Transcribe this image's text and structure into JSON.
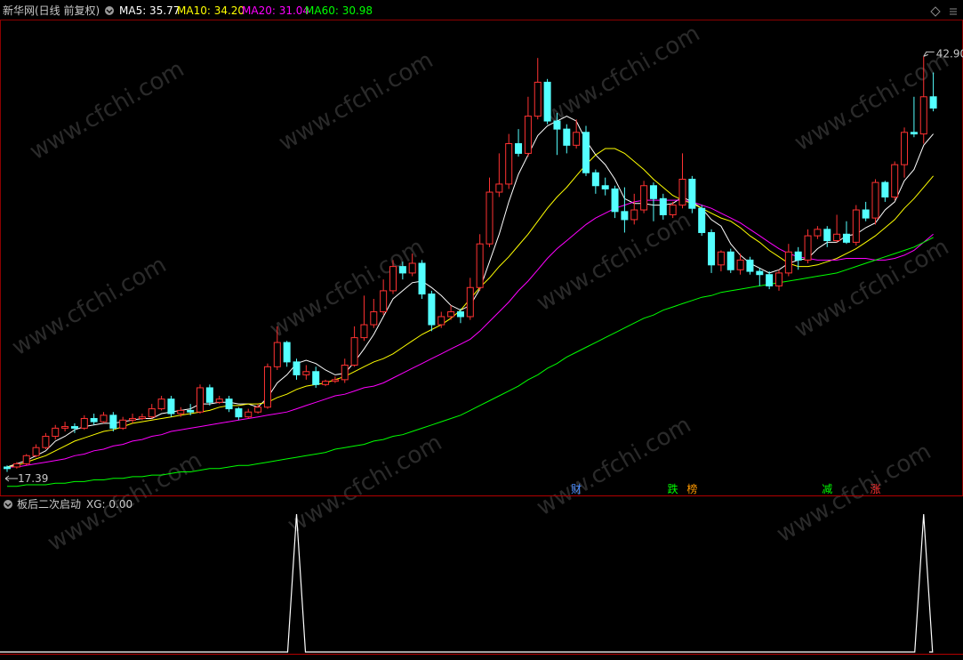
{
  "header": {
    "title": "新华网(日线 前复权)",
    "ma5_label": "MA5: 35.77",
    "ma10_label": "MA10: 34.20",
    "ma20_label": "MA20: 31.04",
    "ma60_label": "MA60: 30.98",
    "colors": {
      "ma5": "#ffffff",
      "ma10": "#ffff00",
      "ma20": "#ff00ff",
      "ma60": "#00ff00"
    }
  },
  "price_annotations": {
    "high": "42.90",
    "low": "17.39"
  },
  "event_tags": [
    {
      "text": "财",
      "color": "#4a8cff",
      "bar": 59
    },
    {
      "text": "跌",
      "color": "#00ff00",
      "bar": 69
    },
    {
      "text": "榜",
      "color": "#ff9900",
      "bar": 71
    },
    {
      "text": "减",
      "color": "#00ff00",
      "bar": 85
    },
    {
      "text": "涨",
      "color": "#ff3333",
      "bar": 90
    }
  ],
  "sub_panel": {
    "title": "板后二次启动",
    "xg_label": "XG: 0.00",
    "signal_bars": [
      30,
      95
    ]
  },
  "bottom_label": "",
  "watermark": "www.cfchi.com",
  "chart_data": {
    "type": "candlestick",
    "title": "新华网(日线 前复权)",
    "price_range": [
      16.5,
      45
    ],
    "candles": [
      [
        17.6,
        17.5,
        17.7,
        17.3
      ],
      [
        17.6,
        17.8,
        17.9,
        17.5
      ],
      [
        17.8,
        18.3,
        18.4,
        17.7
      ],
      [
        18.3,
        18.8,
        19.0,
        18.2
      ],
      [
        18.8,
        19.5,
        19.7,
        18.7
      ],
      [
        19.5,
        20.0,
        20.2,
        19.3
      ],
      [
        20.0,
        20.1,
        20.4,
        19.8
      ],
      [
        20.1,
        20.0,
        20.3,
        19.7
      ],
      [
        20.0,
        20.6,
        20.8,
        19.9
      ],
      [
        20.6,
        20.4,
        20.9,
        20.2
      ],
      [
        20.4,
        20.8,
        21.0,
        20.3
      ],
      [
        20.8,
        20.0,
        21.0,
        19.8
      ],
      [
        20.0,
        20.5,
        20.7,
        19.9
      ],
      [
        20.5,
        20.6,
        20.9,
        20.3
      ],
      [
        20.6,
        20.7,
        20.9,
        20.5
      ],
      [
        20.7,
        21.2,
        21.5,
        20.6
      ],
      [
        21.2,
        21.8,
        22.0,
        21.1
      ],
      [
        21.8,
        20.9,
        22.0,
        20.7
      ],
      [
        20.9,
        21.1,
        21.3,
        20.7
      ],
      [
        21.1,
        21.0,
        21.5,
        20.8
      ],
      [
        21.0,
        22.5,
        22.7,
        20.9
      ],
      [
        22.5,
        21.6,
        22.7,
        21.4
      ],
      [
        21.6,
        21.8,
        22.0,
        21.5
      ],
      [
        21.8,
        21.2,
        22.0,
        21.0
      ],
      [
        21.2,
        20.7,
        21.3,
        20.5
      ],
      [
        20.7,
        21.0,
        21.2,
        20.6
      ],
      [
        21.0,
        21.3,
        21.5,
        20.9
      ],
      [
        21.3,
        23.8,
        24.0,
        21.2
      ],
      [
        23.8,
        25.3,
        26.3,
        23.6
      ],
      [
        25.3,
        24.1,
        25.4,
        23.8
      ],
      [
        24.1,
        23.3,
        24.3,
        23.0
      ],
      [
        23.3,
        23.5,
        23.9,
        23.0
      ],
      [
        23.5,
        22.7,
        23.8,
        22.5
      ],
      [
        22.7,
        22.9,
        23.0,
        22.6
      ],
      [
        22.9,
        23.0,
        23.2,
        22.8
      ],
      [
        23.0,
        23.9,
        24.3,
        22.8
      ],
      [
        23.9,
        25.6,
        26.3,
        23.8
      ],
      [
        25.6,
        26.4,
        28.2,
        25.4
      ],
      [
        26.4,
        27.2,
        28.0,
        26.2
      ],
      [
        27.2,
        28.5,
        29.2,
        27.0
      ],
      [
        28.5,
        30.0,
        30.4,
        28.3
      ],
      [
        30.0,
        29.6,
        30.3,
        29.2
      ],
      [
        29.6,
        30.2,
        30.8,
        29.4
      ],
      [
        30.2,
        28.3,
        30.4,
        28.0
      ],
      [
        28.3,
        26.4,
        28.5,
        26.0
      ],
      [
        26.4,
        26.9,
        27.2,
        26.2
      ],
      [
        26.9,
        27.2,
        27.6,
        26.7
      ],
      [
        27.2,
        26.9,
        27.4,
        26.5
      ],
      [
        26.9,
        28.7,
        29.3,
        26.7
      ],
      [
        28.7,
        31.4,
        32.0,
        28.5
      ],
      [
        31.4,
        34.6,
        35.5,
        31.2
      ],
      [
        34.6,
        35.1,
        37.0,
        34.3
      ],
      [
        35.1,
        37.6,
        38.2,
        34.8
      ],
      [
        37.6,
        37.0,
        38.5,
        36.8
      ],
      [
        37.0,
        39.3,
        40.5,
        36.8
      ],
      [
        39.3,
        41.4,
        42.9,
        39.1
      ],
      [
        41.4,
        39.0,
        41.6,
        38.8
      ],
      [
        39.0,
        38.5,
        39.5,
        36.9
      ],
      [
        38.5,
        37.5,
        38.8,
        37.0
      ],
      [
        37.5,
        38.3,
        39.1,
        37.3
      ],
      [
        38.3,
        35.8,
        38.7,
        35.6
      ],
      [
        35.8,
        35.0,
        36.0,
        34.5
      ],
      [
        35.0,
        34.8,
        35.5,
        34.4
      ],
      [
        34.8,
        33.4,
        35.0,
        33.0
      ],
      [
        33.4,
        32.9,
        34.9,
        32.1
      ],
      [
        32.9,
        33.5,
        34.5,
        32.6
      ],
      [
        33.5,
        35.0,
        35.3,
        33.3
      ],
      [
        35.0,
        34.2,
        35.2,
        32.8
      ],
      [
        34.2,
        33.2,
        34.5,
        32.9
      ],
      [
        33.2,
        33.8,
        34.0,
        33.0
      ],
      [
        33.8,
        35.4,
        37.0,
        33.6
      ],
      [
        35.4,
        33.6,
        35.6,
        33.3
      ],
      [
        33.6,
        32.1,
        33.8,
        31.9
      ],
      [
        32.1,
        30.1,
        32.3,
        29.6
      ],
      [
        30.1,
        30.9,
        31.0,
        29.7
      ],
      [
        30.9,
        29.8,
        31.1,
        29.6
      ],
      [
        29.8,
        30.4,
        30.8,
        29.5
      ],
      [
        30.4,
        29.7,
        30.6,
        29.5
      ],
      [
        29.7,
        29.5,
        29.9,
        28.8
      ],
      [
        29.5,
        28.8,
        29.7,
        28.6
      ],
      [
        28.8,
        29.6,
        29.8,
        28.5
      ],
      [
        29.6,
        30.9,
        31.4,
        29.4
      ],
      [
        30.9,
        30.4,
        31.2,
        29.8
      ],
      [
        30.4,
        31.9,
        32.3,
        30.2
      ],
      [
        31.9,
        32.3,
        32.5,
        31.7
      ],
      [
        32.3,
        31.6,
        32.5,
        31.2
      ],
      [
        31.6,
        32.0,
        33.2,
        31.5
      ],
      [
        32.0,
        31.5,
        32.8,
        31.4
      ],
      [
        31.5,
        33.5,
        33.8,
        31.3
      ],
      [
        33.5,
        33.0,
        34.0,
        32.8
      ],
      [
        33.0,
        35.2,
        35.4,
        32.6
      ],
      [
        35.2,
        34.3,
        35.3,
        34.0
      ],
      [
        34.3,
        36.3,
        36.5,
        34.1
      ],
      [
        36.3,
        38.3,
        38.6,
        35.5
      ],
      [
        38.3,
        38.2,
        40.5,
        38.0
      ],
      [
        38.2,
        40.5,
        43.0,
        37.6
      ],
      [
        40.5,
        39.8,
        42.0,
        39.6
      ]
    ],
    "series": [
      {
        "name": "MA5",
        "color": "#ffffff",
        "values": [
          17.6,
          17.8,
          18.0,
          18.3,
          18.6,
          19.2,
          19.5,
          19.9,
          20.1,
          20.2,
          20.3,
          20.3,
          20.4,
          20.5,
          20.6,
          20.6,
          20.9,
          21.0,
          21.1,
          21.2,
          21.5,
          21.5,
          21.6,
          21.6,
          21.5,
          21.5,
          21.3,
          21.9,
          22.8,
          23.3,
          24.0,
          24.2,
          24.0,
          23.6,
          23.3,
          23.4,
          24.1,
          24.9,
          25.8,
          26.9,
          28.0,
          28.5,
          29.0,
          29.1,
          28.7,
          28.2,
          27.6,
          27.3,
          27.6,
          28.6,
          30.3,
          32.0,
          34.0,
          35.7,
          36.9,
          38.1,
          38.7,
          39.0,
          39.3,
          39.0,
          37.8,
          36.9,
          36.3,
          35.4,
          34.2,
          33.9,
          33.9,
          33.8,
          33.8,
          33.9,
          34.3,
          34.0,
          33.6,
          32.9,
          32.5,
          31.4,
          30.7,
          30.2,
          29.9,
          29.6,
          29.8,
          30.2,
          30.4,
          30.5,
          31.1,
          31.5,
          31.5,
          31.9,
          32.0,
          32.4,
          32.7,
          33.5,
          34.0,
          35.3,
          36.0,
          37.5,
          38.2
        ]
      },
      {
        "name": "MA10",
        "color": "#ffff00",
        "values": [
          17.6,
          17.7,
          17.9,
          18.1,
          18.3,
          18.6,
          18.9,
          19.2,
          19.4,
          19.6,
          19.8,
          19.9,
          20.1,
          20.3,
          20.4,
          20.5,
          20.6,
          20.7,
          20.8,
          20.9,
          21.0,
          21.1,
          21.3,
          21.4,
          21.4,
          21.5,
          21.5,
          21.6,
          21.9,
          22.1,
          22.4,
          22.6,
          22.7,
          22.8,
          23.0,
          23.2,
          23.5,
          23.8,
          24.1,
          24.3,
          24.6,
          25.0,
          25.4,
          25.8,
          26.1,
          26.4,
          26.8,
          27.3,
          28.0,
          28.7,
          29.3,
          30.0,
          30.6,
          31.3,
          32.0,
          32.8,
          33.6,
          34.3,
          34.9,
          35.6,
          36.3,
          36.9,
          37.3,
          37.3,
          37.0,
          36.5,
          36.0,
          35.4,
          34.9,
          34.4,
          34.1,
          33.9,
          33.6,
          33.3,
          33.0,
          32.8,
          32.4,
          31.9,
          31.5,
          31.0,
          30.6,
          30.2,
          30.0,
          30.0,
          30.1,
          30.3,
          30.5,
          30.8,
          31.1,
          31.5,
          31.9,
          32.4,
          32.9,
          33.6,
          34.2,
          34.9,
          35.6
        ]
      },
      {
        "name": "MA20",
        "color": "#ff00ff",
        "values": [
          17.6,
          17.6,
          17.7,
          17.8,
          17.9,
          18.0,
          18.1,
          18.3,
          18.4,
          18.6,
          18.7,
          18.9,
          19.0,
          19.2,
          19.3,
          19.5,
          19.6,
          19.8,
          19.9,
          20.0,
          20.1,
          20.2,
          20.3,
          20.4,
          20.5,
          20.6,
          20.7,
          20.8,
          20.9,
          21.0,
          21.2,
          21.4,
          21.6,
          21.8,
          22.0,
          22.1,
          22.3,
          22.5,
          22.6,
          22.8,
          23.1,
          23.4,
          23.7,
          24.0,
          24.3,
          24.6,
          24.9,
          25.2,
          25.5,
          26.0,
          26.6,
          27.2,
          27.8,
          28.5,
          29.1,
          29.8,
          30.5,
          31.1,
          31.6,
          32.1,
          32.6,
          33.0,
          33.3,
          33.6,
          33.8,
          34.0,
          34.1,
          34.1,
          34.1,
          34.1,
          34.1,
          34.0,
          33.8,
          33.6,
          33.3,
          33.0,
          32.7,
          32.3,
          31.9,
          31.5,
          31.1,
          30.8,
          30.6,
          30.5,
          30.4,
          30.4,
          30.4,
          30.5,
          30.5,
          30.5,
          30.4,
          30.4,
          30.5,
          30.7,
          31.0,
          31.5,
          32.0
        ]
      },
      {
        "name": "MA60",
        "color": "#00ff00",
        "values": [
          16.4,
          16.4,
          16.5,
          16.5,
          16.5,
          16.6,
          16.6,
          16.7,
          16.7,
          16.8,
          16.8,
          16.9,
          16.9,
          17.0,
          17.0,
          17.1,
          17.1,
          17.2,
          17.3,
          17.3,
          17.4,
          17.5,
          17.5,
          17.6,
          17.7,
          17.7,
          17.8,
          17.9,
          18.0,
          18.1,
          18.2,
          18.3,
          18.4,
          18.5,
          18.7,
          18.8,
          18.9,
          19.0,
          19.2,
          19.3,
          19.5,
          19.6,
          19.8,
          20.0,
          20.2,
          20.4,
          20.6,
          20.8,
          21.1,
          21.4,
          21.7,
          22.0,
          22.3,
          22.6,
          23.0,
          23.3,
          23.7,
          24.0,
          24.4,
          24.7,
          25.0,
          25.3,
          25.6,
          25.9,
          26.2,
          26.5,
          26.8,
          27.0,
          27.3,
          27.5,
          27.7,
          27.9,
          28.1,
          28.2,
          28.4,
          28.5,
          28.6,
          28.7,
          28.8,
          28.9,
          29.0,
          29.1,
          29.2,
          29.3,
          29.4,
          29.5,
          29.6,
          29.8,
          30.0,
          30.2,
          30.4,
          30.6,
          30.8,
          31.0,
          31.2,
          31.5,
          31.8
        ]
      }
    ],
    "indicator": {
      "name": "XG",
      "signal_bars": [
        30,
        95
      ]
    },
    "grid": false
  }
}
